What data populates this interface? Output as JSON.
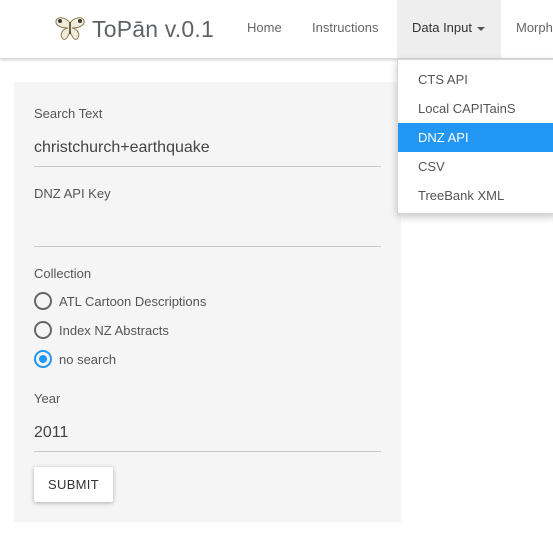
{
  "brand": {
    "title": "ToPān v.0.1",
    "icon": "butterfly-icon"
  },
  "nav": {
    "home": "Home",
    "instructions": "Instructions",
    "data_input": "Data Input",
    "morph": "Morph"
  },
  "dropdown": {
    "items": [
      "CTS API",
      "Local CAPITainS",
      "DNZ API",
      "CSV",
      "TreeBank XML"
    ],
    "active_index": 2
  },
  "form": {
    "search_label": "Search Text",
    "search_value": "christchurch+earthquake",
    "api_key_label": "DNZ API Key",
    "api_key_value": "",
    "collection_label": "Collection",
    "collection_options": [
      "ATL Cartoon Descriptions",
      "Index NZ Abstracts",
      "no search"
    ],
    "selected_collection": "no search",
    "year_label": "Year",
    "year_value": "2011",
    "submit_label": "SUBMIT"
  },
  "colors": {
    "accent": "#2196f3"
  }
}
